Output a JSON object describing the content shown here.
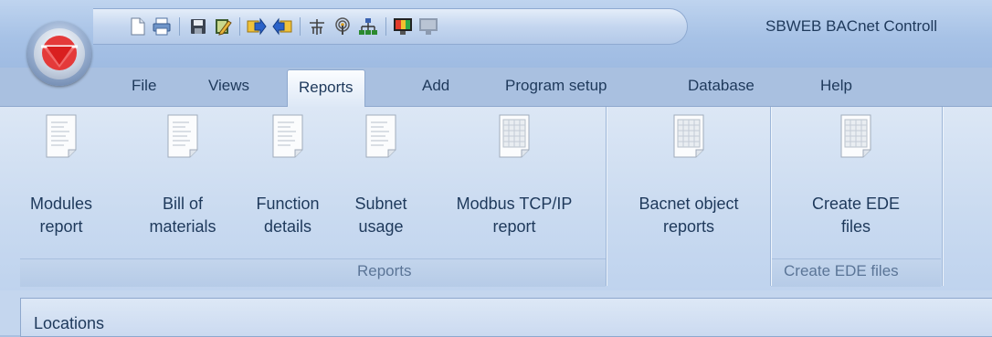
{
  "window": {
    "title": "SBWEB BACnet Controll",
    "accent_color": "#1e395b",
    "orb_logo": "red-down-triangle-logo"
  },
  "quick_access_toolbar": {
    "icons": [
      "new-document-icon",
      "print-icon",
      "save-icon",
      "edit-icon",
      "export-icon",
      "import-icon",
      "antenna-icon",
      "wireless-icon",
      "network-icon",
      "monitor-color-icon",
      "monitor-disabled-icon"
    ]
  },
  "menu": {
    "tabs": [
      {
        "label": "File"
      },
      {
        "label": "Views"
      },
      {
        "label": "Reports",
        "active": true
      },
      {
        "label": "Add"
      },
      {
        "label": "Program setup"
      },
      {
        "label": "Database"
      },
      {
        "label": "Help"
      }
    ]
  },
  "ribbon": {
    "groups": [
      {
        "label": "Reports",
        "buttons": [
          {
            "line1": "Modules",
            "line2": "report",
            "icon": "text-report-icon"
          },
          {
            "line1": "Bill of",
            "line2": "materials",
            "icon": "text-report-icon"
          },
          {
            "line1": "Function",
            "line2": "details",
            "icon": "text-report-icon"
          },
          {
            "line1": "Subnet",
            "line2": "usage",
            "icon": "text-report-icon"
          },
          {
            "line1": "Modbus TCP/IP",
            "line2": "report",
            "icon": "table-report-icon"
          }
        ]
      },
      {
        "label": "",
        "buttons": [
          {
            "line1": "Bacnet object",
            "line2": "reports",
            "icon": "table-report-icon"
          }
        ]
      },
      {
        "label": "Create EDE files",
        "buttons": [
          {
            "line1": "Create EDE",
            "line2": "files",
            "icon": "table-report-icon"
          }
        ]
      }
    ]
  },
  "panel": {
    "title": "Locations"
  }
}
